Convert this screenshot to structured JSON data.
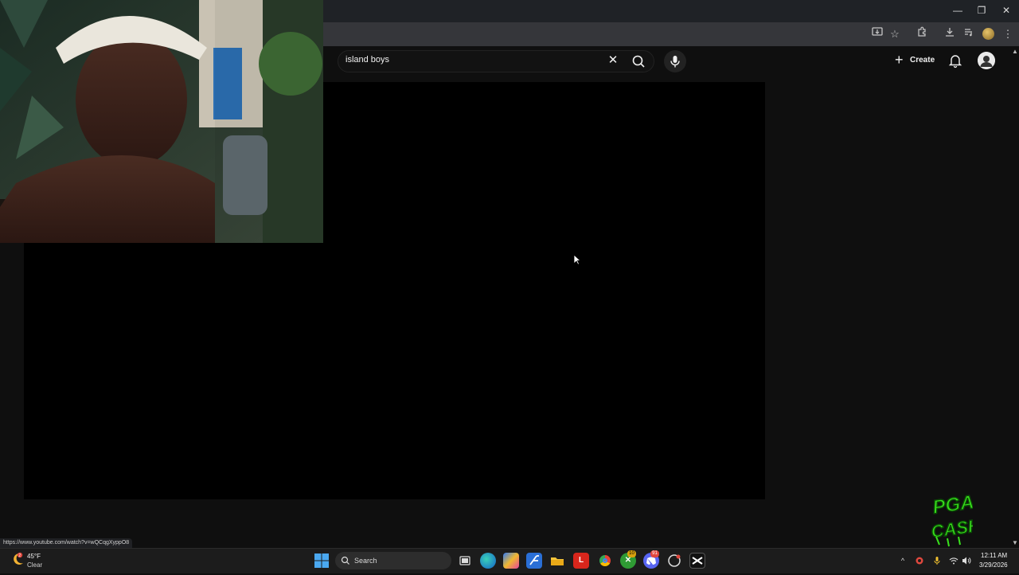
{
  "browser": {
    "window_controls": {
      "minimize": "—",
      "restore": "❐",
      "close": "✕"
    },
    "toolbar_icons": [
      "install-app-icon",
      "bookmark-star-icon",
      "extensions-icon",
      "downloads-icon",
      "media-controls-icon",
      "profile-icon",
      "kebab-menu-icon"
    ]
  },
  "youtube": {
    "search_query": "island boys",
    "create_label": "Create"
  },
  "status_bar": {
    "url": "https://www.youtube.com/watch?v=wQCqgXyppO8"
  },
  "overlay": {
    "logo_text": "PGA CASH"
  },
  "taskbar": {
    "weather_temp": "45°F",
    "weather_condition": "Clear",
    "weather_badge": "2",
    "search_label": "Search",
    "apps": [
      "task-view",
      "edge",
      "copilot",
      "visual-studio",
      "file-explorer",
      "lenovo-l",
      "chrome",
      "xbox",
      "discord",
      "app-circle",
      "capcut"
    ],
    "xbox_badge": "10",
    "discord_badge": "91",
    "clock_time": "12:11 AM",
    "clock_date": "3/29/2026"
  },
  "colors": {
    "youtube_bg": "#0f0f0f",
    "player_bg": "#000000",
    "taskbar_bg": "#1c1c1c",
    "logo_green": "#39e21c"
  }
}
